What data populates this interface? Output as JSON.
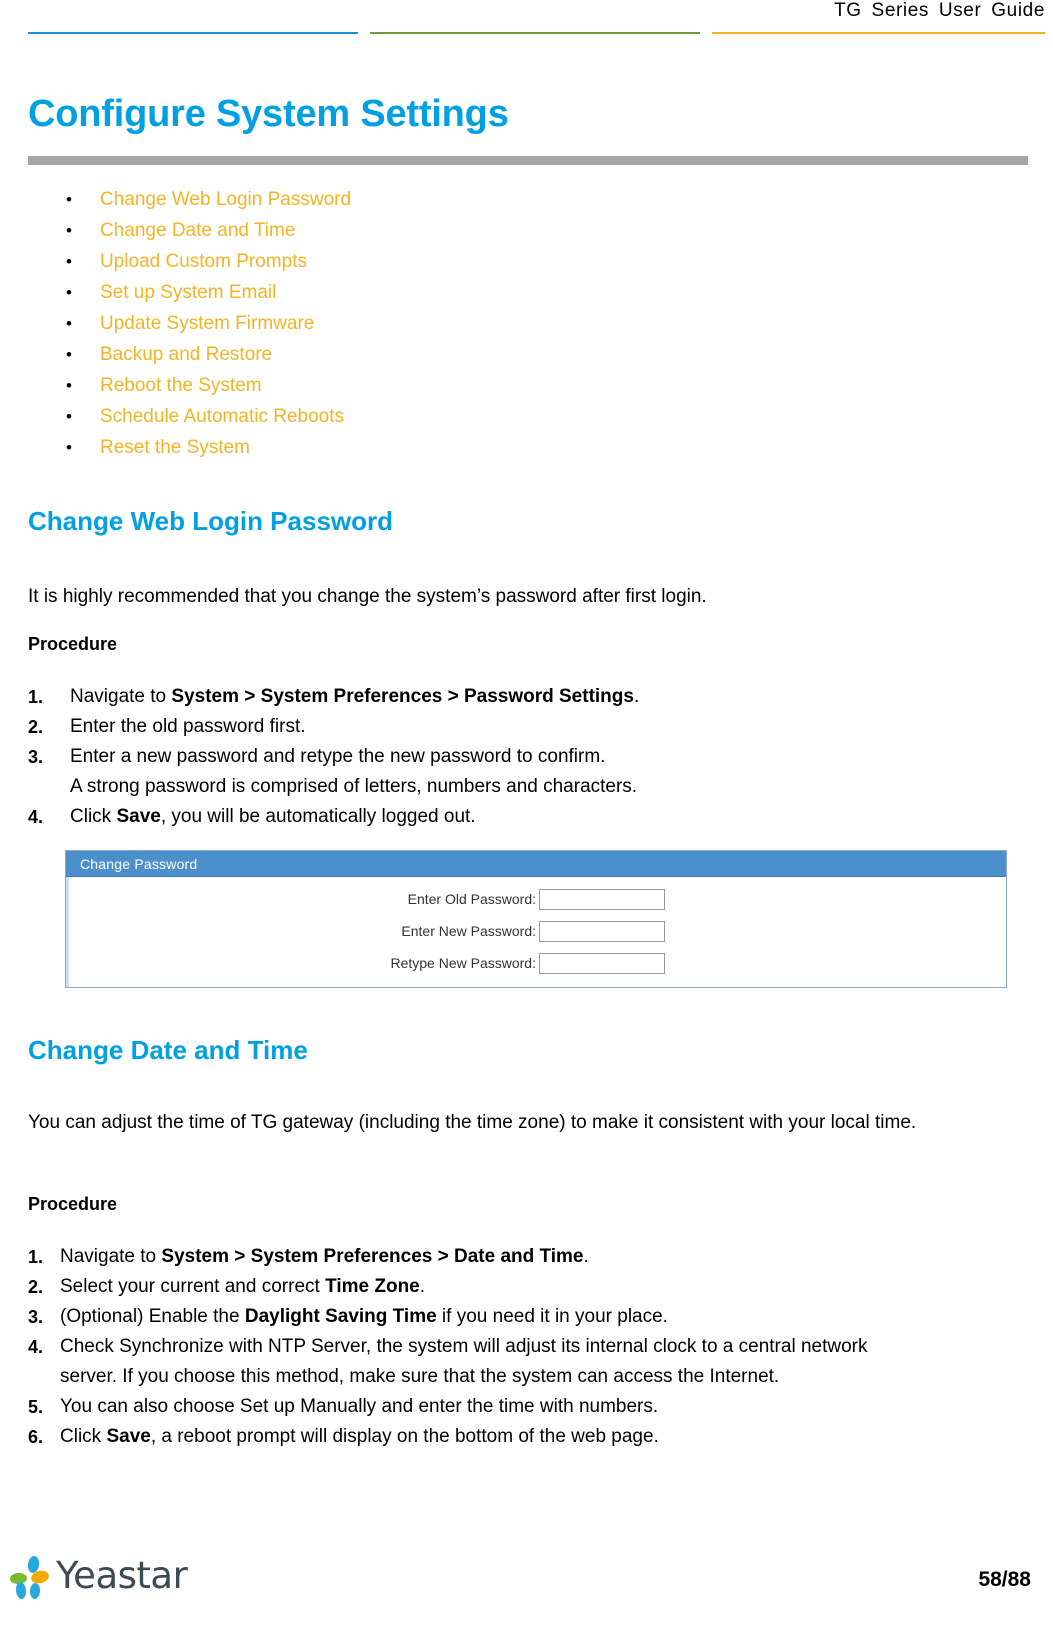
{
  "header": {
    "title": "TG Series User Guide",
    "rule_colors": {
      "blue": "#1f8fd4",
      "green": "#6c9c33",
      "orange": "#f5b324"
    }
  },
  "page_title": "Configure System Settings",
  "accent_colors": {
    "heading_blue": "#00a0e3",
    "link_orange": "#f5b324",
    "title_bar_gray": "#a6a6a6"
  },
  "toc": {
    "items": [
      {
        "label": "Change Web Login Password"
      },
      {
        "label": "Change Date and Time"
      },
      {
        "label": "Upload Custom Prompts"
      },
      {
        "label": "Set up System Email"
      },
      {
        "label": "Update System Firmware"
      },
      {
        "label": "Backup and Restore"
      },
      {
        "label": "Reboot the System"
      },
      {
        "label": "Schedule Automatic Reboots"
      },
      {
        "label": "Reset the System"
      }
    ]
  },
  "section_password": {
    "heading": "Change Web Login Password",
    "intro": "It is highly recommended that you change the system’s password after first login.",
    "procedure_label": "Procedure",
    "steps": [
      {
        "num": "1.",
        "prefix": "Navigate to ",
        "bold": "System > System Preferences > Password Settings",
        "suffix": ".",
        "cont": ""
      },
      {
        "num": "2.",
        "prefix": "Enter the old password first.",
        "bold": "",
        "suffix": "",
        "cont": ""
      },
      {
        "num": "3.",
        "prefix": "Enter a new password and retype the new password to confirm.",
        "bold": "",
        "suffix": "",
        "cont": "A strong password is comprised of letters, numbers and characters."
      },
      {
        "num": "4.",
        "prefix": "Click ",
        "bold": "Save",
        "suffix": ", you will be automatically logged out.",
        "cont": ""
      }
    ],
    "screenshot": {
      "panel_title": "Change Password",
      "panel_title_bg": "#4b90cc",
      "fields": [
        {
          "label": "Enter Old Password:",
          "value": ""
        },
        {
          "label": "Enter New Password:",
          "value": ""
        },
        {
          "label": "Retype New Password:",
          "value": ""
        }
      ]
    }
  },
  "section_datetime": {
    "heading": "Change Date and Time",
    "intro_line1": "You can adjust the time of TG gateway (including the time zone) to make it consistent with your local",
    "intro_line2": "time.",
    "procedure_label": "Procedure",
    "steps": [
      {
        "num": "1.",
        "prefix": "Navigate to ",
        "bold": "System > System Preferences > Date and Time",
        "suffix": ".",
        "cont": ""
      },
      {
        "num": "2.",
        "prefix": "Select your current and correct ",
        "bold": "Time Zone",
        "suffix": ".",
        "cont": ""
      },
      {
        "num": "3.",
        "prefix": "(Optional) Enable the ",
        "bold": "Daylight Saving Time",
        "suffix": " if you need it in your place.",
        "cont": ""
      },
      {
        "num": "4.",
        "prefix": "Check Synchronize with NTP Server, the system will adjust its internal clock to a central network",
        "bold": "",
        "suffix": "",
        "cont": "server. If you choose this method, make sure that the system can access the Internet."
      },
      {
        "num": "5.",
        "prefix": "You can also choose Set up Manually  and enter the time with numbers.",
        "bold": "",
        "suffix": "",
        "cont": ""
      },
      {
        "num": "6.",
        "prefix": "Click ",
        "bold": "Save",
        "suffix": ", a reboot prompt will display on the bottom of the web page.",
        "cont": ""
      }
    ]
  },
  "footer": {
    "logo_text": "Yeastar",
    "page_number": "58/88"
  }
}
